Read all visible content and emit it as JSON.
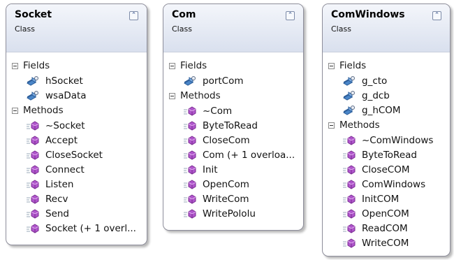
{
  "classes": [
    {
      "name": "Socket",
      "type": "Class",
      "fields_label": "Fields",
      "fields": [
        "hSocket",
        "wsaData"
      ],
      "methods_label": "Methods",
      "methods": [
        "~Socket",
        "Accept",
        "CloseSocket",
        "Connect",
        "Listen",
        "Recv",
        "Send",
        "Socket (+ 1 overl..."
      ]
    },
    {
      "name": "Com",
      "type": "Class",
      "fields_label": "Fields",
      "fields": [
        "portCom"
      ],
      "methods_label": "Methods",
      "methods": [
        "~Com",
        "ByteToRead",
        "CloseCom",
        "Com (+ 1 overloa...",
        "Init",
        "OpenCom",
        "WriteCom",
        "WritePololu"
      ]
    },
    {
      "name": "ComWindows",
      "type": "Class",
      "fields_label": "Fields",
      "fields": [
        "g_cto",
        "g_dcb",
        "g_hCOM"
      ],
      "methods_label": "Methods",
      "methods": [
        "~ComWindows",
        "ByteToRead",
        "CloseCOM",
        "ComWindows",
        "InitCOM",
        "OpenCOM",
        "ReadCOM",
        "WriteCOM"
      ]
    }
  ],
  "icons": {
    "field": "field-icon",
    "method": "method-icon",
    "collapse": "collapse-icon"
  },
  "colors": {
    "header_top": "#f4f6fb",
    "header_bottom": "#d9e0ee",
    "method_icon": "#b056cc",
    "field_icon": "#4a86c8"
  }
}
